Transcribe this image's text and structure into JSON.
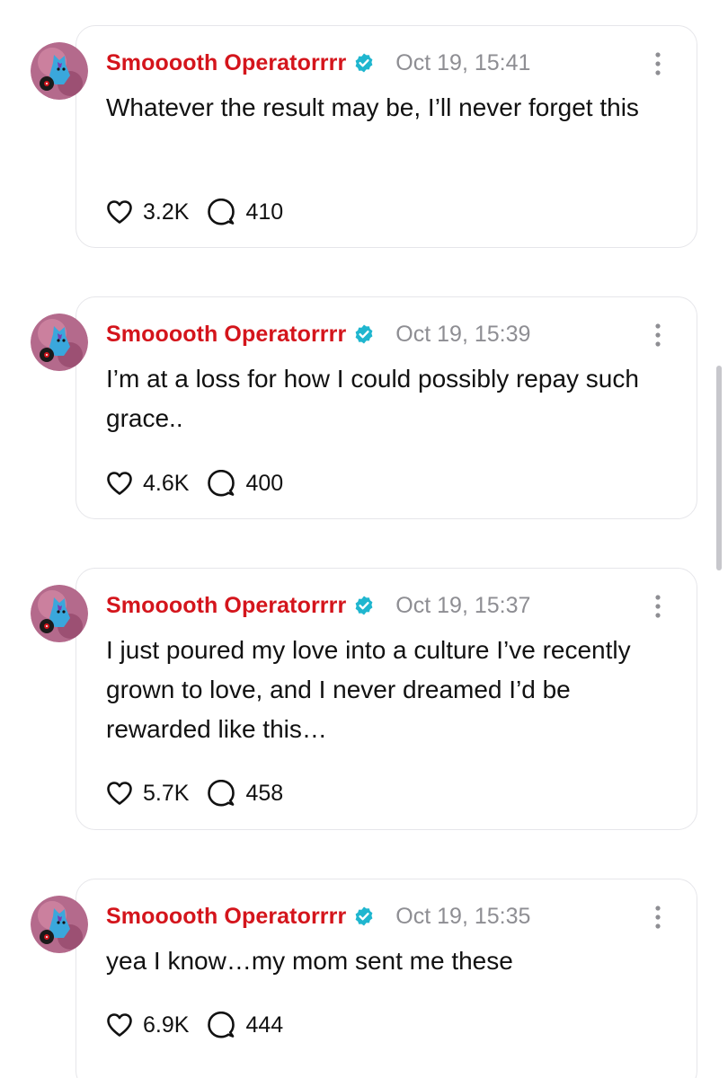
{
  "posts": [
    {
      "author": "Smooooth Operatorrrr",
      "time": "Oct 19, 15:41",
      "text": "Whatever the result may be, I’ll never forget this",
      "likes": "3.2K",
      "replies": "410"
    },
    {
      "author": "Smooooth Operatorrrr",
      "time": "Oct 19, 15:39",
      "text": "I’m at a loss for how I could possibly repay such grace..",
      "likes": "4.6K",
      "replies": "400"
    },
    {
      "author": "Smooooth Operatorrrr",
      "time": "Oct 19, 15:37",
      "text": "I just poured my love into a culture I’ve recently grown to love, and I never dreamed I’d be rewarded like this…",
      "likes": "5.7K",
      "replies": "458"
    },
    {
      "author": "Smooooth Operatorrrr",
      "time": "Oct 19, 15:35",
      "text": "yea I know…my mom sent me these",
      "likes": "6.9K",
      "replies": "444"
    }
  ],
  "colors": {
    "author": "#d4151c",
    "verified": "#1fb6cf",
    "timestamp": "#8e8e93",
    "border": "#e6e6ea"
  },
  "icons": {
    "verified": "verified-badge-icon",
    "more": "more-vertical-icon",
    "like": "heart-icon",
    "reply": "comment-bubble-icon"
  }
}
